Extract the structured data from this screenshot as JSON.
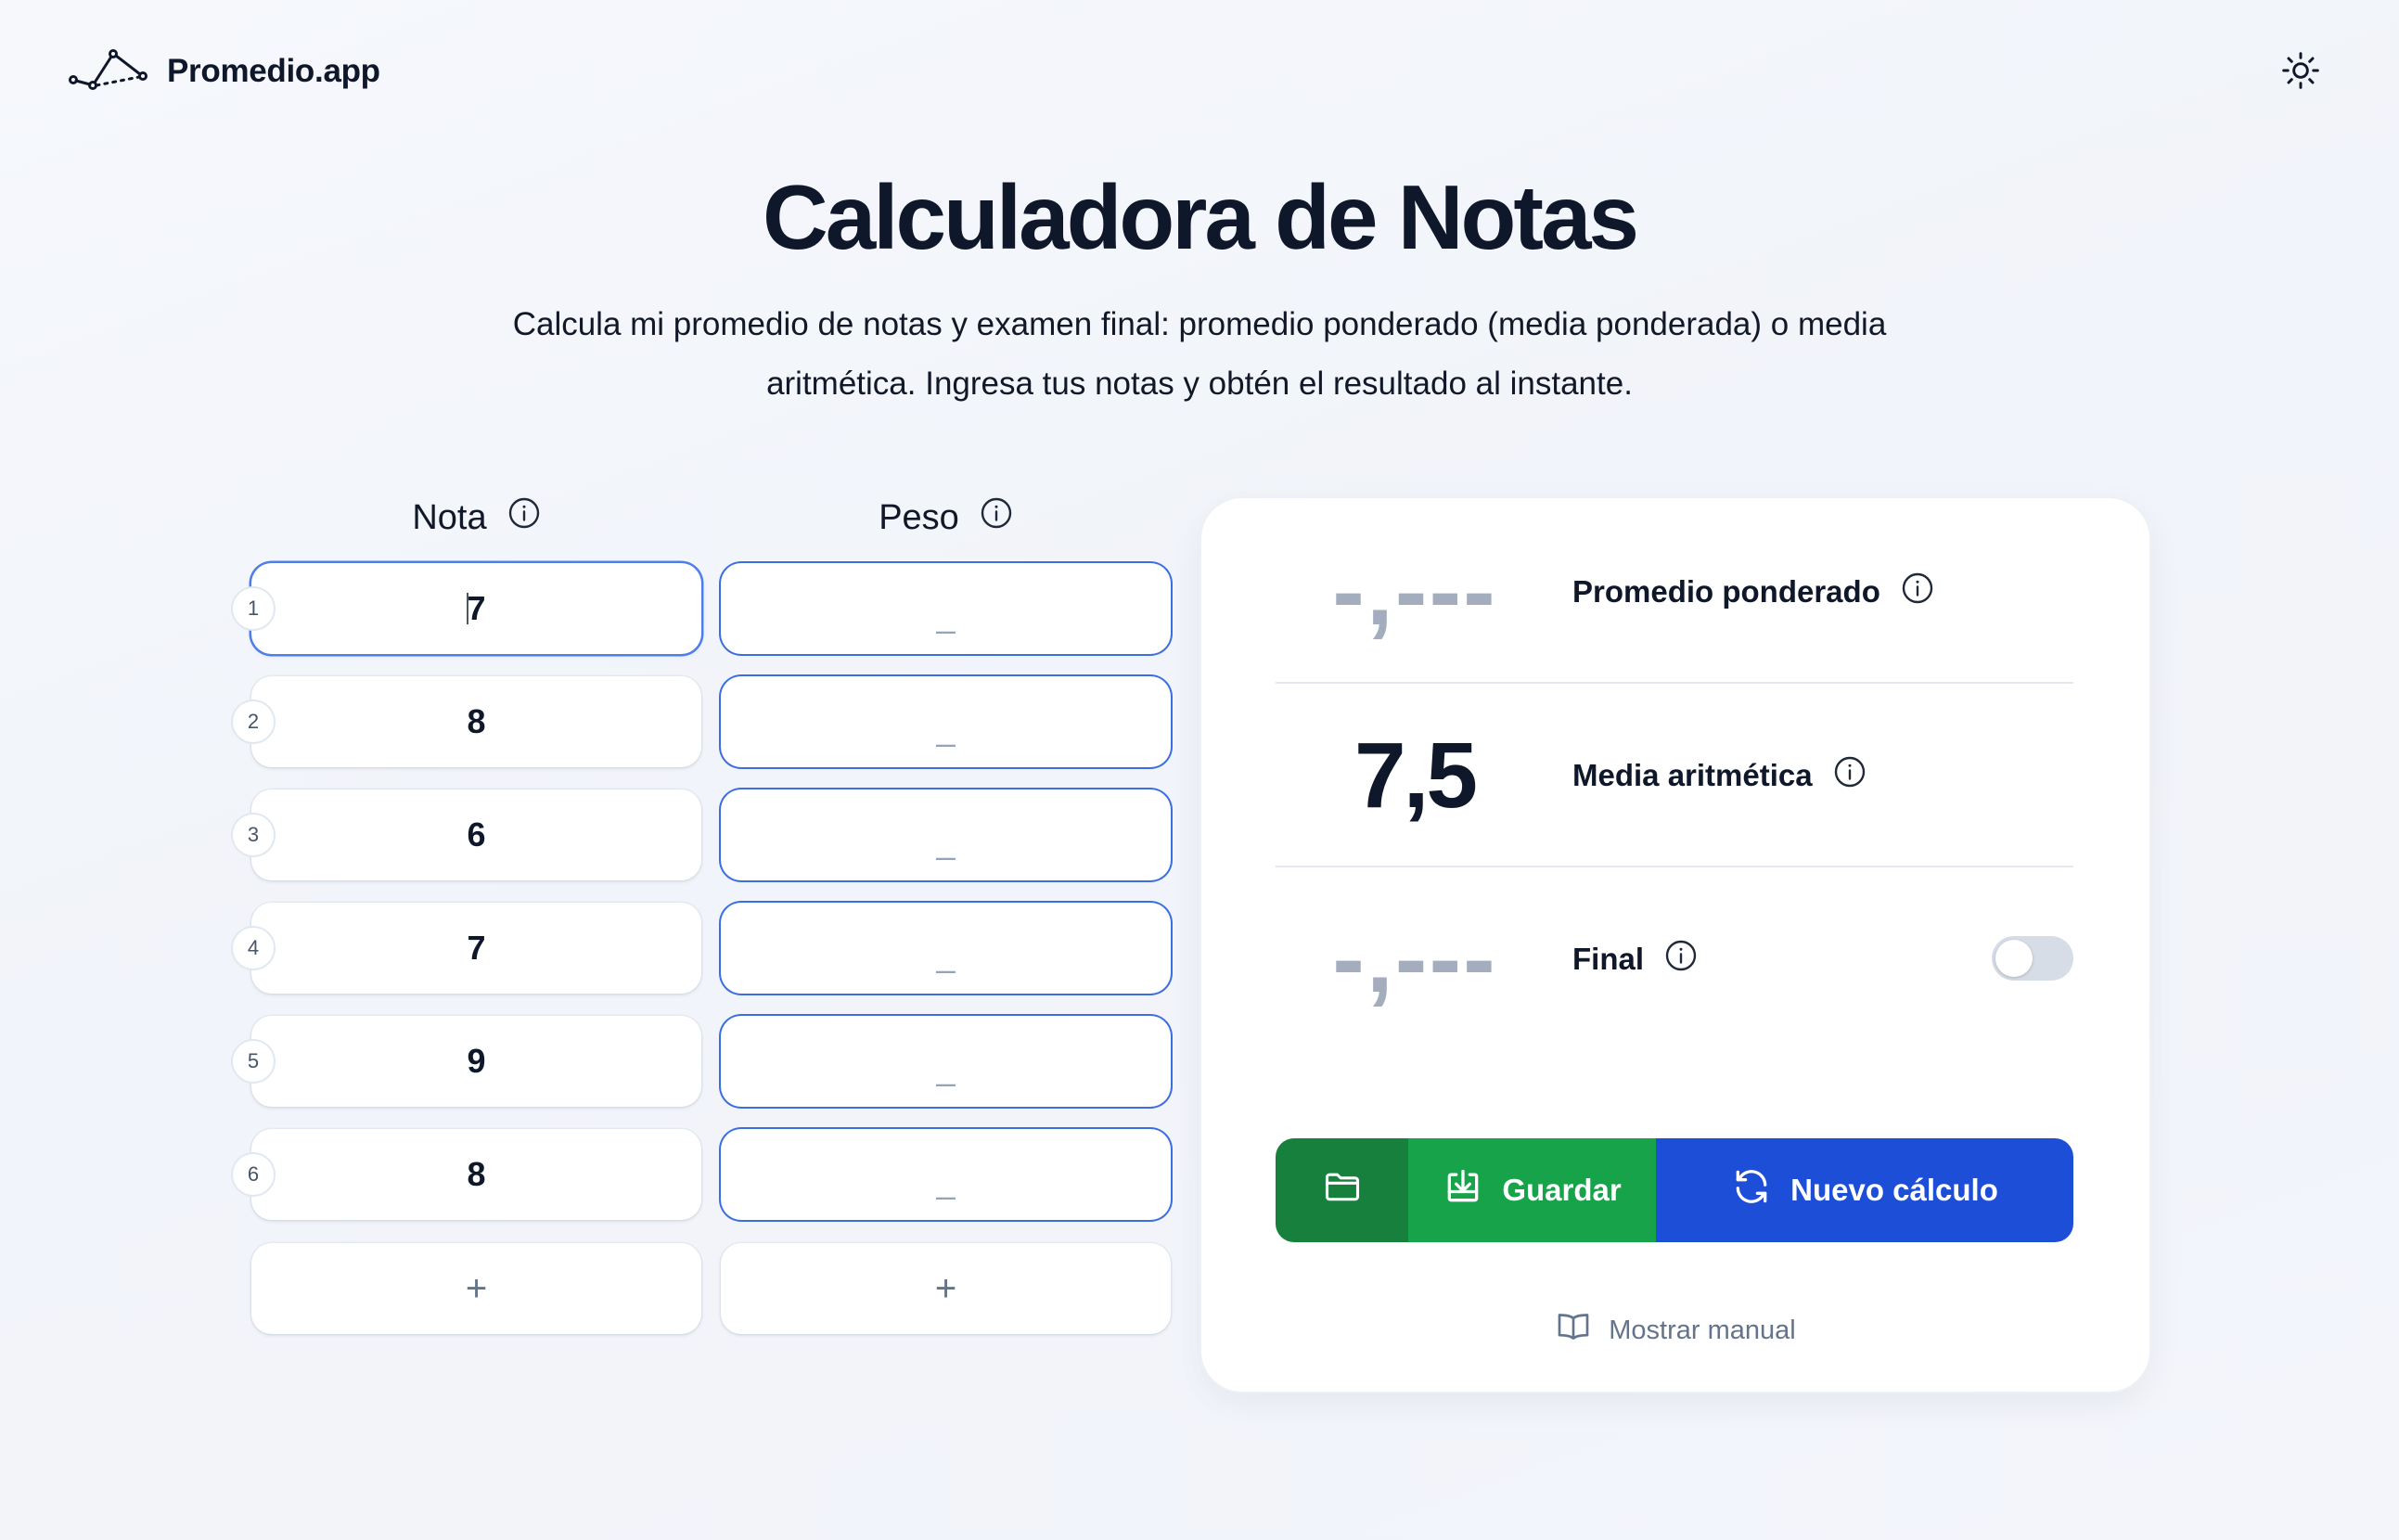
{
  "header": {
    "app_name": "Promedio.app",
    "logo_icon": "line-chart-logo-icon",
    "theme_toggle_icon": "sun-icon"
  },
  "hero": {
    "title": "Calculadora de Notas",
    "subtitle": "Calcula mi promedio de notas y examen final: promedio ponderado (media ponderada) o media aritmética. Ingresa tus notas y obtén el resultado al instante."
  },
  "table": {
    "col_nota": "Nota",
    "col_peso": "Peso",
    "rows": [
      {
        "num": "1",
        "nota": "7",
        "peso": "_"
      },
      {
        "num": "2",
        "nota": "8",
        "peso": "_"
      },
      {
        "num": "3",
        "nota": "6",
        "peso": "_"
      },
      {
        "num": "4",
        "nota": "7",
        "peso": "_"
      },
      {
        "num": "5",
        "nota": "9",
        "peso": "_"
      },
      {
        "num": "6",
        "nota": "8",
        "peso": "_"
      }
    ],
    "add_label": "+"
  },
  "results": {
    "weighted": {
      "value": "-,---",
      "label": "Promedio ponderado"
    },
    "arithmetic": {
      "value": "7,5",
      "label": "Media aritmética"
    },
    "final": {
      "value": "-,---",
      "label": "Final",
      "toggle_on": false
    }
  },
  "actions": {
    "open_icon": "folder-icon",
    "save_label": "Guardar",
    "new_label": "Nuevo cálculo"
  },
  "manual_label": "Mostrar manual",
  "colors": {
    "accent_blue": "#1d4ed8",
    "save_green": "#17a34a",
    "folder_green": "#17803d",
    "placeholder_gray": "#a3adbd"
  }
}
